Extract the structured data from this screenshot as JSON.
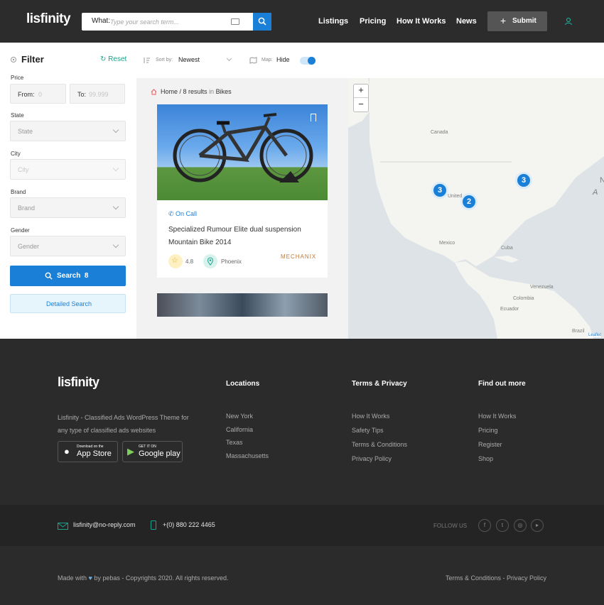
{
  "header": {
    "logo": "lisfinity",
    "search_label": "What:",
    "search_placeholder": "Type your search term...",
    "nav": [
      "Listings",
      "Pricing",
      "How It Works",
      "News"
    ],
    "submit_label": "Submit"
  },
  "filter": {
    "title": "Filter",
    "reset": "Reset",
    "price_label": "Price",
    "from_label": "From:",
    "from_placeholder": "0",
    "to_label": "To:",
    "to_placeholder": "99.999",
    "state_label": "State",
    "state_value": "State",
    "city_label": "City",
    "city_value": "City",
    "brand_label": "Brand",
    "brand_value": "Brand",
    "gender_label": "Gender",
    "gender_value": "Gender",
    "search_button": "Search  8",
    "detailed_search": "Detailed Search"
  },
  "toolbar": {
    "sort_label": "Sort by:",
    "sort_value": "Newest",
    "map_label": "Map:",
    "map_value": "Hide",
    "map_toggle_on": true
  },
  "breadcrumb": {
    "home": "Home",
    "results": "/ 8 results",
    "in": "in",
    "category": "Bikes"
  },
  "listing": {
    "availability": "On Call",
    "title": "Specialized Rumour Elite dual suspension Mountain Bike 2014",
    "rating": "4.8",
    "location": "Phoenix",
    "brand_logo": "MECHANIX"
  },
  "map": {
    "zoom_in": "+",
    "zoom_out": "−",
    "labels": [
      "Canada",
      "United",
      "Mexico",
      "Cuba",
      "Venezuela",
      "Colombia",
      "Ecuador",
      "Brazil",
      "N",
      "A"
    ],
    "clusters": [
      "3",
      "2",
      "3"
    ],
    "attribution": "Leaflet"
  },
  "footer": {
    "logo": "lisfinity",
    "description": "Lisfinity - Classified Ads WordPress Theme for any type of classified ads websites",
    "app_store_small": "Download on the",
    "app_store_big": "App Store",
    "google_small": "GET IT ON",
    "google_big": "Google play",
    "columns": [
      {
        "title": "Locations",
        "links": [
          "New York",
          "California",
          "Texas",
          "Massachusetts"
        ]
      },
      {
        "title": "Terms & Privacy",
        "links": [
          "How It Works",
          "Safety Tips",
          "Terms & Conditions",
          "Privacy Policy"
        ]
      },
      {
        "title": "Find out more",
        "links": [
          "How It Works",
          "Pricing",
          "Register",
          "Shop"
        ]
      }
    ],
    "email": "lisfinity@no-reply.com",
    "phone": "+(0) 880 222 4465",
    "follow_us": "FOLLOW US",
    "made_with_prefix": "Made with",
    "made_with_suffix": "by pebas - Copyrights 2020. All rights reserved.",
    "bottom_links": "Terms & Conditions - Privacy Policy"
  },
  "colors": {
    "accent": "#1a7fd6",
    "reset_green": "#1aa38a",
    "header_bg": "#2c2c2c",
    "footer_bg": "#2b2b2b"
  }
}
